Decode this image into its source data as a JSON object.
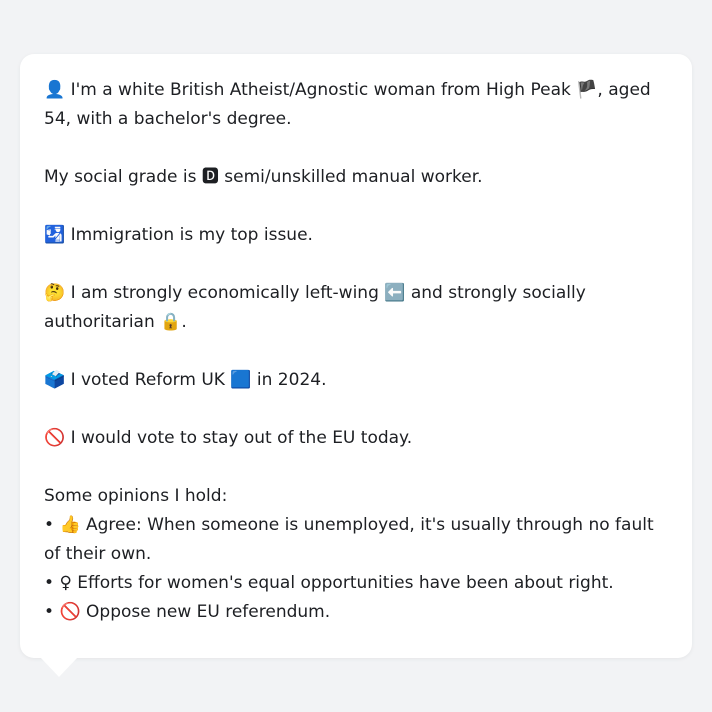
{
  "profile": {
    "intro_emoji": "👤",
    "intro_text": "I'm a white British Atheist/Agnostic woman from High Peak",
    "region_flag": "🏴",
    "intro_text_2": ", aged 54, with a bachelor's degree.",
    "grade_text": "My social grade is",
    "grade_emoji": "🅳",
    "grade_text_2": "semi/unskilled manual worker.",
    "issue_emoji": "🛂",
    "issue_text": "Immigration is my top issue.",
    "stance_emoji": "🤔",
    "stance_text": "I am strongly economically left-wing",
    "left_emoji": "⬅️",
    "stance_text_2": "and strongly socially authoritarian",
    "auth_emoji": "🔒",
    "stance_end": ".",
    "vote_emoji": "🗳️",
    "vote_text": "I voted Reform UK",
    "party_emoji": "🟦",
    "vote_text_2": "in 2024.",
    "eu_emoji": "🚫",
    "eu_text": "I would vote to stay out of the EU today.",
    "opinions_heading": "Some opinions I hold:",
    "opinions": [
      {
        "bullet": "•",
        "emoji": "👍",
        "text": "Agree: When someone is unemployed, it's usually through no fault of their own."
      },
      {
        "bullet": "•",
        "emoji": "♀",
        "text": " Efforts for women's equal opportunities have been about right."
      },
      {
        "bullet": "•",
        "emoji": "🚫",
        "text": "Oppose new EU referendum."
      }
    ]
  }
}
